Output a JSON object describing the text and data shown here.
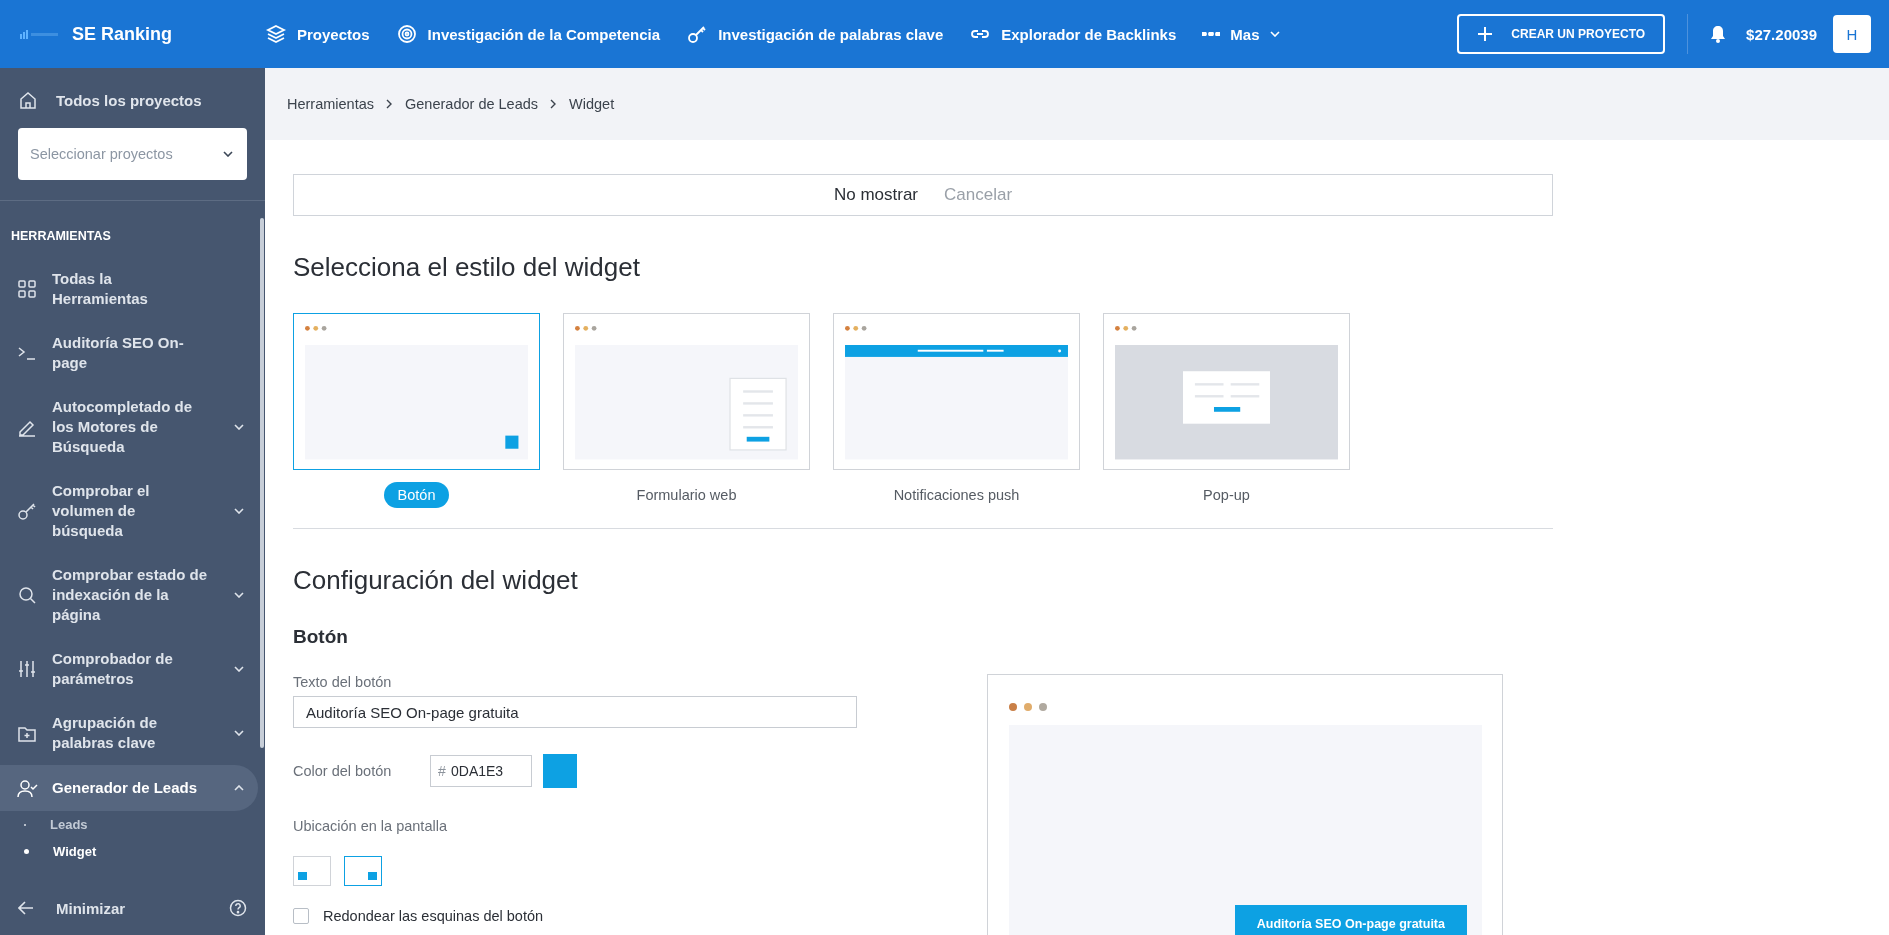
{
  "topbar": {
    "logo": "SE Ranking",
    "nav": [
      {
        "label": "Proyectos"
      },
      {
        "label": "Investigación de la Competencia"
      },
      {
        "label": "Investigación de palabras clave"
      },
      {
        "label": "Explorador de Backlinks"
      }
    ],
    "more": "Mas",
    "create_button": "CREAR UN PROYECTO",
    "balance": "$27.20039",
    "avatar": "H"
  },
  "sidebar": {
    "all_projects": "Todos los proyectos",
    "project_select": {
      "placeholder": "Seleccionar proyectos"
    },
    "section": "HERRAMIENTAS",
    "items": [
      {
        "label": "Todas la Herramientas",
        "selected": false
      },
      {
        "label": "Auditoría SEO On-page",
        "selected": false
      },
      {
        "label": "Autocompletado de los Motores de Búsqueda",
        "selected": false,
        "expanded": false
      },
      {
        "label": "Comprobar el volumen de búsqueda",
        "selected": false,
        "expanded": false
      },
      {
        "label": "Comprobar estado de indexación de la página",
        "selected": false,
        "expanded": false
      },
      {
        "label": "Comprobador de parámetros",
        "selected": false,
        "expanded": false
      },
      {
        "label": "Agrupación de palabras clave",
        "selected": false,
        "expanded": false
      },
      {
        "label": "Generador de Leads",
        "selected": true,
        "expanded": true,
        "children": [
          {
            "label": "Leads",
            "selected": false
          },
          {
            "label": "Widget",
            "selected": true
          }
        ]
      }
    ],
    "minimize": "Minimizar"
  },
  "breadcrumb": [
    "Herramientas",
    "Generador de Leads",
    "Widget"
  ],
  "notice": {
    "primary": "No mostrar",
    "secondary": "Cancelar"
  },
  "style_section": {
    "title": "Selecciona el estilo del widget",
    "styles": [
      {
        "label": "Botón",
        "kind": "button",
        "selected": true
      },
      {
        "label": "Formulario web",
        "kind": "form",
        "selected": false
      },
      {
        "label": "Notificaciones push",
        "kind": "push",
        "selected": false
      },
      {
        "label": "Pop-up",
        "kind": "popup",
        "selected": false
      }
    ]
  },
  "config": {
    "title": "Configuración del widget",
    "subtitle": "Botón",
    "text_label": "Texto del botón",
    "text_value": "Auditoría SEO On-page gratuita",
    "color_label": "Color del botón",
    "color_prefix": "#",
    "color_value": "0DA1E3",
    "position_label": "Ubicación en la pantalla",
    "positions": [
      {
        "kind": "left",
        "selected": false
      },
      {
        "kind": "right",
        "selected": true
      }
    ],
    "round_corners": {
      "label": "Redondear las esquinas del botón",
      "checked": false
    },
    "preview": {
      "button_text": "Auditoría SEO On-page gratuita"
    }
  }
}
